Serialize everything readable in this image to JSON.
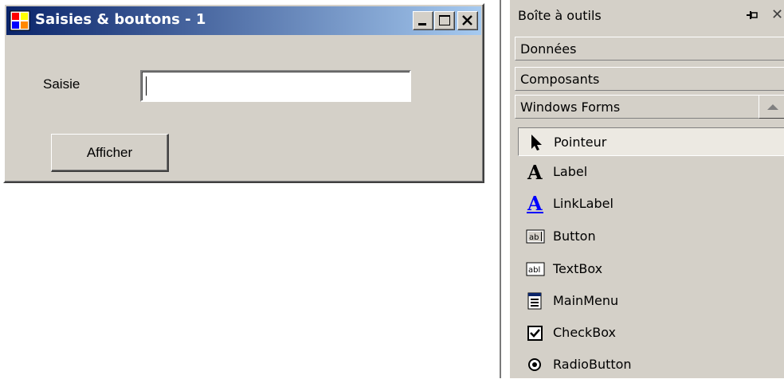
{
  "form": {
    "title": "Saisies & boutons - 1",
    "label": "Saisie",
    "input_value": "",
    "button_label": "Afficher"
  },
  "toolbox": {
    "title": "Boîte à outils",
    "tabs": [
      "Données",
      "Composants",
      "Windows Forms"
    ],
    "items": [
      {
        "label": "Pointeur",
        "icon": "pointer-icon"
      },
      {
        "label": "Label",
        "icon": "label-icon"
      },
      {
        "label": "LinkLabel",
        "icon": "linklabel-icon"
      },
      {
        "label": "Button",
        "icon": "button-icon"
      },
      {
        "label": "TextBox",
        "icon": "textbox-icon"
      },
      {
        "label": "MainMenu",
        "icon": "mainmenu-icon"
      },
      {
        "label": "CheckBox",
        "icon": "checkbox-icon"
      },
      {
        "label": "RadioButton",
        "icon": "radiobutton-icon"
      }
    ]
  },
  "colors": {
    "titlebar_start": "#0a246a",
    "titlebar_end": "#a6caf0",
    "face": "#d4d0c8",
    "link": "#0000ff"
  }
}
